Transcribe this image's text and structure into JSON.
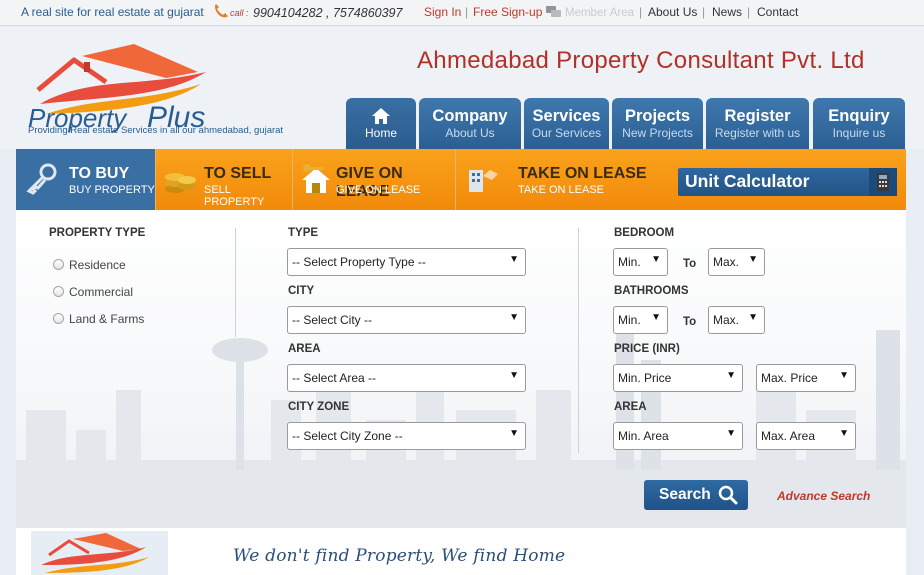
{
  "topbar": {
    "tagline": "A real site for real estate at gujarat",
    "call_label": "call :",
    "phones": "9904104282 , 7574860397",
    "sign_in": "Sign In",
    "sign_up": "Free Sign-up",
    "member_area": "Member Area",
    "about": "About Us",
    "news": "News",
    "contact": "Contact"
  },
  "header": {
    "logo_text_1": "Property",
    "logo_text_2": "Plus",
    "logo_tagline": "Providing Real estate Services in all our ahmedabad, gujarat",
    "company_name": "Ahmedabad Property Consultant Pvt. Ltd"
  },
  "nav": [
    {
      "title": "",
      "subtitle": "Home"
    },
    {
      "title": "Company",
      "subtitle": "About Us"
    },
    {
      "title": "Services",
      "subtitle": "Our Services"
    },
    {
      "title": "Projects",
      "subtitle": "New Projects"
    },
    {
      "title": "Register",
      "subtitle": "Register with us"
    },
    {
      "title": "Enquiry",
      "subtitle": "Inquire us"
    }
  ],
  "actions": [
    {
      "title": "TO BUY",
      "subtitle": "BUY PROPERTY"
    },
    {
      "title": "TO SELL",
      "subtitle": "SELL PROPERTY"
    },
    {
      "title": "GIVE ON LEASE",
      "subtitle": "GIVE ON LEASE"
    },
    {
      "title": "TAKE ON LEASE",
      "subtitle": "TAKE ON LEASE"
    }
  ],
  "unit_calculator": "Unit Calculator",
  "search": {
    "property_type_label": "PROPERTY TYPE",
    "property_types": [
      "Residence",
      "Commercial",
      "Land & Farms"
    ],
    "type_label": "TYPE",
    "type_value": "-- Select Property Type --",
    "city_label": "CITY",
    "city_value": "-- Select City --",
    "area_label": "AREA",
    "area_value": "-- Select Area --",
    "city_zone_label": "CITY ZONE",
    "city_zone_value": "-- Select City Zone --",
    "bedroom_label": "BEDROOM",
    "bathrooms_label": "BATHROOMS",
    "price_label": "PRICE (INR)",
    "area2_label": "AREA",
    "min": "Min.",
    "max": "Max.",
    "to": "To",
    "min_price": "Min. Price",
    "max_price": "Max. Price",
    "min_area": "Min. Area",
    "max_area": "Max. Area",
    "search_button": "Search",
    "advanced_search": "Advance Search"
  },
  "footer": {
    "motto": "We don't find Property, We find Home"
  },
  "colors": {
    "brand_blue": "#2b5f93",
    "orange": "#f28a0b",
    "accent_red": "#b33027"
  }
}
